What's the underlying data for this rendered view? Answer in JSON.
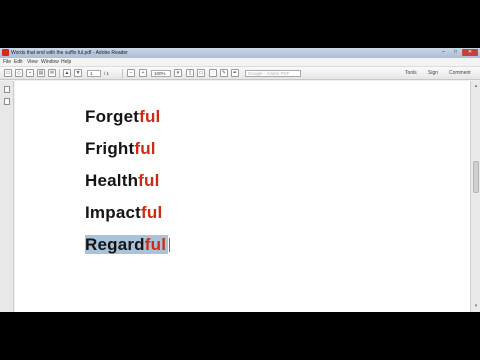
{
  "window": {
    "title": "Words that end with the suffix ful.pdf - Adobe Reader",
    "controls": {
      "minimize": "–",
      "maximize": "□",
      "close": "✕"
    }
  },
  "menu": {
    "items": [
      "File",
      "Edit",
      "View",
      "Window",
      "Help"
    ]
  },
  "toolbar": {
    "page_current": "1",
    "page_total": "/ 1",
    "zoom_out": "–",
    "zoom_in": "+",
    "zoom_value": "100%",
    "sign_field_placeholder": "Google - Adobe PDF",
    "tools_label": "Tools",
    "sign_label": "Sign",
    "comment_label": "Comment"
  },
  "document": {
    "words": [
      {
        "stem": "Forget",
        "suffix": "ful"
      },
      {
        "stem": "Fright",
        "suffix": "ful"
      },
      {
        "stem": "Health",
        "suffix": "ful"
      },
      {
        "stem": "Impact",
        "suffix": "ful"
      },
      {
        "stem": "Regard",
        "suffix": "ful"
      }
    ],
    "selected_word_index": 4
  },
  "colors": {
    "stem": "#141414",
    "suffix": "#d12a12",
    "selection": "#a9c4da"
  }
}
